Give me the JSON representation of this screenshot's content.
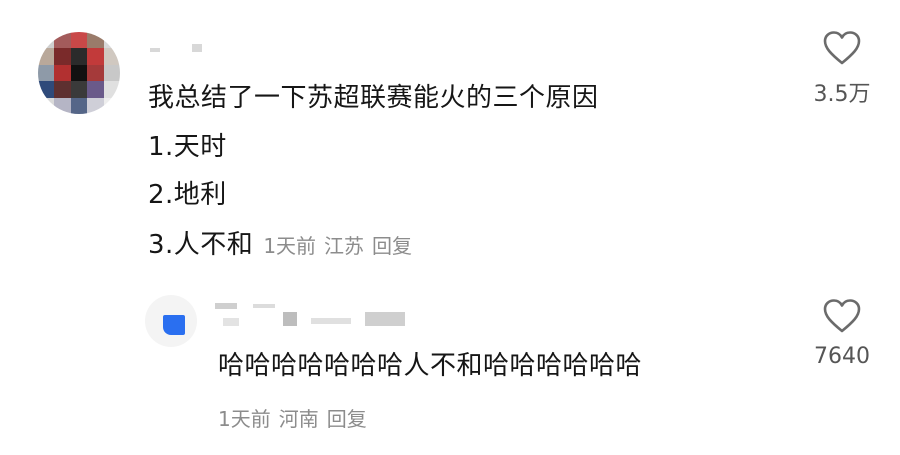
{
  "comment": {
    "lines": [
      "我总结了一下苏超联赛能火的三个原因",
      "1.天时",
      "2.地利",
      "3.人不和"
    ],
    "time": "1天前",
    "location": "江苏",
    "reply_label": "回复",
    "like_count": "3.5万",
    "like_icon": "heart-outline-icon"
  },
  "reply": {
    "text": "哈哈哈哈哈哈哈人不和哈哈哈哈哈哈",
    "time": "1天前",
    "location": "河南",
    "reply_label": "回复",
    "like_count": "7640",
    "like_icon": "heart-outline-icon"
  },
  "colors": {
    "text": "#161616",
    "meta": "#8c8c8c",
    "count": "#555555",
    "reply_avatar_accent": "#2a6ff0"
  }
}
